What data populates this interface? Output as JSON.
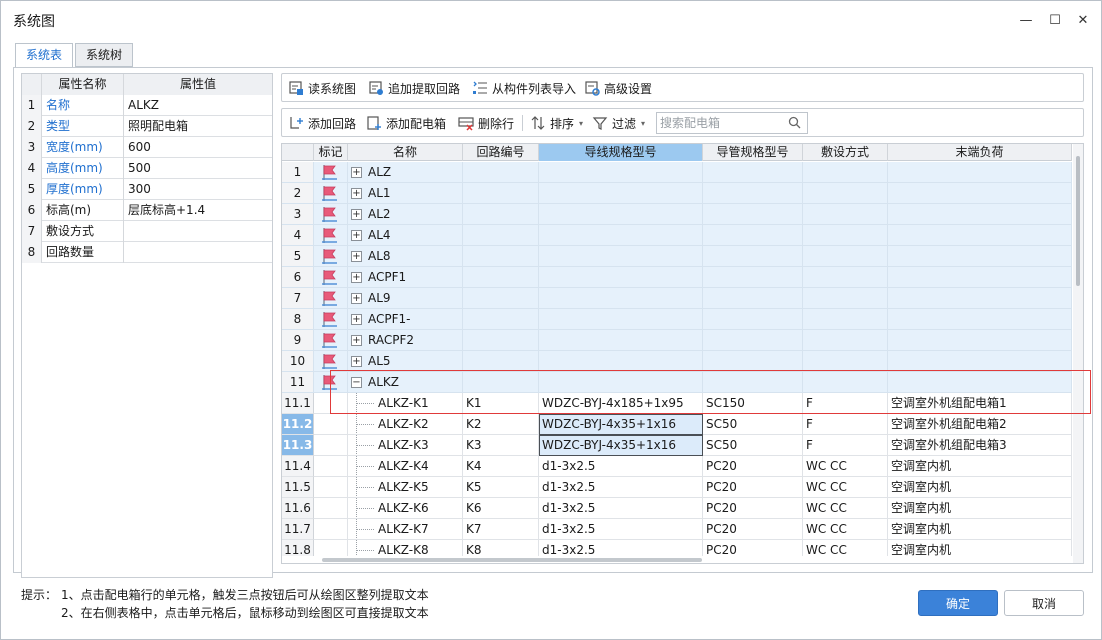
{
  "window": {
    "title": "系统图",
    "minimize": "—",
    "maximize": "☐",
    "close": "✕"
  },
  "tabs": [
    {
      "label": "系统表",
      "active": true
    },
    {
      "label": "系统树",
      "active": false
    }
  ],
  "property_grid": {
    "headers": {
      "name": "属性名称",
      "value": "属性值"
    },
    "rows": [
      {
        "index": "1",
        "name": "名称",
        "value": "ALKZ",
        "highlight": true
      },
      {
        "index": "2",
        "name": "类型",
        "value": "照明配电箱",
        "highlight": true
      },
      {
        "index": "3",
        "name": "宽度(mm)",
        "value": "600",
        "highlight": true
      },
      {
        "index": "4",
        "name": "高度(mm)",
        "value": "500",
        "highlight": true
      },
      {
        "index": "5",
        "name": "厚度(mm)",
        "value": "300",
        "highlight": true
      },
      {
        "index": "6",
        "name": "标高(m)",
        "value": "层底标高+1.4",
        "highlight": false
      },
      {
        "index": "7",
        "name": "敷设方式",
        "value": "",
        "highlight": false
      },
      {
        "index": "8",
        "name": "回路数量",
        "value": "",
        "highlight": false
      }
    ]
  },
  "toolbar1": {
    "read": "读系统图",
    "append": "追加提取回路",
    "import": "从构件列表导入",
    "advanced": "高级设置"
  },
  "toolbar2": {
    "add_circuit": "添加回路",
    "add_box": "添加配电箱",
    "delete_row": "删除行",
    "sort": "排序",
    "filter": "过滤",
    "search_placeholder": "搜索配电箱"
  },
  "grid": {
    "headers": {
      "index": "",
      "mark": "标记",
      "name": "名称",
      "circuit": "回路编号",
      "wire": "导线规格型号",
      "conduit": "导管规格型号",
      "laying": "敷设方式",
      "load": "末端负荷"
    },
    "rows": [
      {
        "index": "1",
        "name": "ALZ",
        "circuit": "",
        "wire": "",
        "conduit": "",
        "laying": "",
        "load": ""
      },
      {
        "index": "2",
        "name": "AL1",
        "circuit": "",
        "wire": "",
        "conduit": "",
        "laying": "",
        "load": ""
      },
      {
        "index": "3",
        "name": "AL2",
        "circuit": "",
        "wire": "",
        "conduit": "",
        "laying": "",
        "load": ""
      },
      {
        "index": "4",
        "name": "AL4",
        "circuit": "",
        "wire": "",
        "conduit": "",
        "laying": "",
        "load": ""
      },
      {
        "index": "5",
        "name": "AL8",
        "circuit": "",
        "wire": "",
        "conduit": "",
        "laying": "",
        "load": ""
      },
      {
        "index": "6",
        "name": "ACPF1",
        "circuit": "",
        "wire": "",
        "conduit": "",
        "laying": "",
        "load": ""
      },
      {
        "index": "7",
        "name": "AL9",
        "circuit": "",
        "wire": "",
        "conduit": "",
        "laying": "",
        "load": ""
      },
      {
        "index": "8",
        "name": "ACPF1-",
        "circuit": "",
        "wire": "",
        "conduit": "",
        "laying": "",
        "load": ""
      },
      {
        "index": "9",
        "name": "RACPF2",
        "circuit": "",
        "wire": "",
        "conduit": "",
        "laying": "",
        "load": ""
      },
      {
        "index": "10",
        "name": "AL5",
        "circuit": "",
        "wire": "",
        "conduit": "",
        "laying": "",
        "load": ""
      },
      {
        "index": "11",
        "name": "ALKZ",
        "circuit": "",
        "wire": "",
        "conduit": "",
        "laying": "",
        "load": ""
      },
      {
        "index": "11.1",
        "name": "ALKZ-K1",
        "circuit": "K1",
        "wire": "WDZC-BYJ-4x185+1x95",
        "conduit": "SC150",
        "laying": "F",
        "load": "空调室外机组配电箱1"
      },
      {
        "index": "11.2",
        "name": "ALKZ-K2",
        "circuit": "K2",
        "wire": "WDZC-BYJ-4x35+1x16",
        "conduit": "SC50",
        "laying": "F",
        "load": "空调室外机组配电箱2"
      },
      {
        "index": "11.3",
        "name": "ALKZ-K3",
        "circuit": "K3",
        "wire": "WDZC-BYJ-4x35+1x16",
        "conduit": "SC50",
        "laying": "F",
        "load": "空调室外机组配电箱3"
      },
      {
        "index": "11.4",
        "name": "ALKZ-K4",
        "circuit": "K4",
        "wire": "d1-3x2.5",
        "conduit": "PC20",
        "laying": "WC CC",
        "load": "空调室内机"
      },
      {
        "index": "11.5",
        "name": "ALKZ-K5",
        "circuit": "K5",
        "wire": "d1-3x2.5",
        "conduit": "PC20",
        "laying": "WC CC",
        "load": "空调室内机"
      },
      {
        "index": "11.6",
        "name": "ALKZ-K6",
        "circuit": "K6",
        "wire": "d1-3x2.5",
        "conduit": "PC20",
        "laying": "WC CC",
        "load": "空调室内机"
      },
      {
        "index": "11.7",
        "name": "ALKZ-K7",
        "circuit": "K7",
        "wire": "d1-3x2.5",
        "conduit": "PC20",
        "laying": "WC CC",
        "load": "空调室内机"
      },
      {
        "index": "11.8",
        "name": "ALKZ-K8",
        "circuit": "K8",
        "wire": "d1-3x2.5",
        "conduit": "PC20",
        "laying": "WC CC",
        "load": "空调室内机"
      }
    ]
  },
  "tips": {
    "label": "提示：",
    "line1": "1、点击配电箱行的单元格，触发三点按钮后可从绘图区整列提取文本",
    "line2": "2、在右侧表格中，点击单元格后，鼠标移动到绘图区可直接提取文本"
  },
  "buttons": {
    "ok": "确定",
    "cancel": "取消"
  },
  "colors": {
    "accent": "#3b82d9",
    "selected_column": "#9cc9f0",
    "highlight_box": "#e03a3a",
    "group_row": "#e6f1fb"
  }
}
